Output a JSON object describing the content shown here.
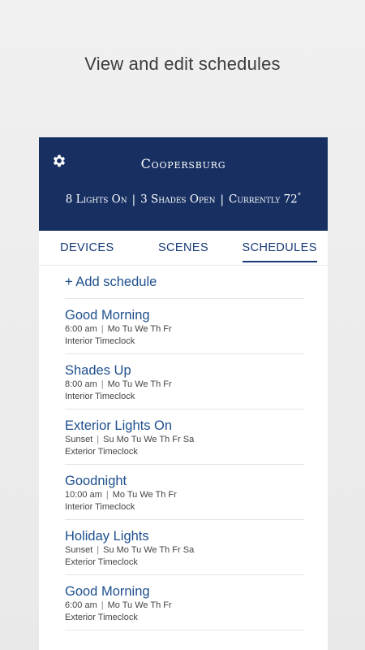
{
  "promo": {
    "caption": "View and edit schedules"
  },
  "header": {
    "title": "Coopersburg",
    "status": {
      "lights": "8 Lights On",
      "shades": "3 Shades Open",
      "temperature": "Currently 72",
      "degree": "°"
    }
  },
  "tabs": [
    {
      "label": "DEVICES"
    },
    {
      "label": "SCENES"
    },
    {
      "label": "SCHEDULES"
    }
  ],
  "add_schedule": {
    "label": "+ Add schedule"
  },
  "schedules": [
    {
      "name": "Good Morning",
      "time": "6:00 am",
      "days": "Mo Tu We Th Fr",
      "source": "Interior Timeclock"
    },
    {
      "name": "Shades Up",
      "time": "8:00 am",
      "days": "Mo Tu We Th Fr",
      "source": "Interior Timeclock"
    },
    {
      "name": "Exterior Lights On",
      "time": "Sunset",
      "days": "Su Mo Tu We Th Fr Sa",
      "source": "Exterior Timeclock"
    },
    {
      "name": "Goodnight",
      "time": "10:00 am",
      "days": "Mo Tu We Th Fr",
      "source": "Interior Timeclock"
    },
    {
      "name": "Holiday Lights",
      "time": "Sunset",
      "days": "Su Mo Tu We Th Fr Sa",
      "source": "Exterior Timeclock"
    },
    {
      "name": "Good Morning",
      "time": "6:00 am",
      "days": "Mo Tu We Th Fr",
      "source": "Exterior Timeclock"
    }
  ],
  "colors": {
    "header_bg": "#172f61",
    "accent": "#1d4f8c"
  }
}
